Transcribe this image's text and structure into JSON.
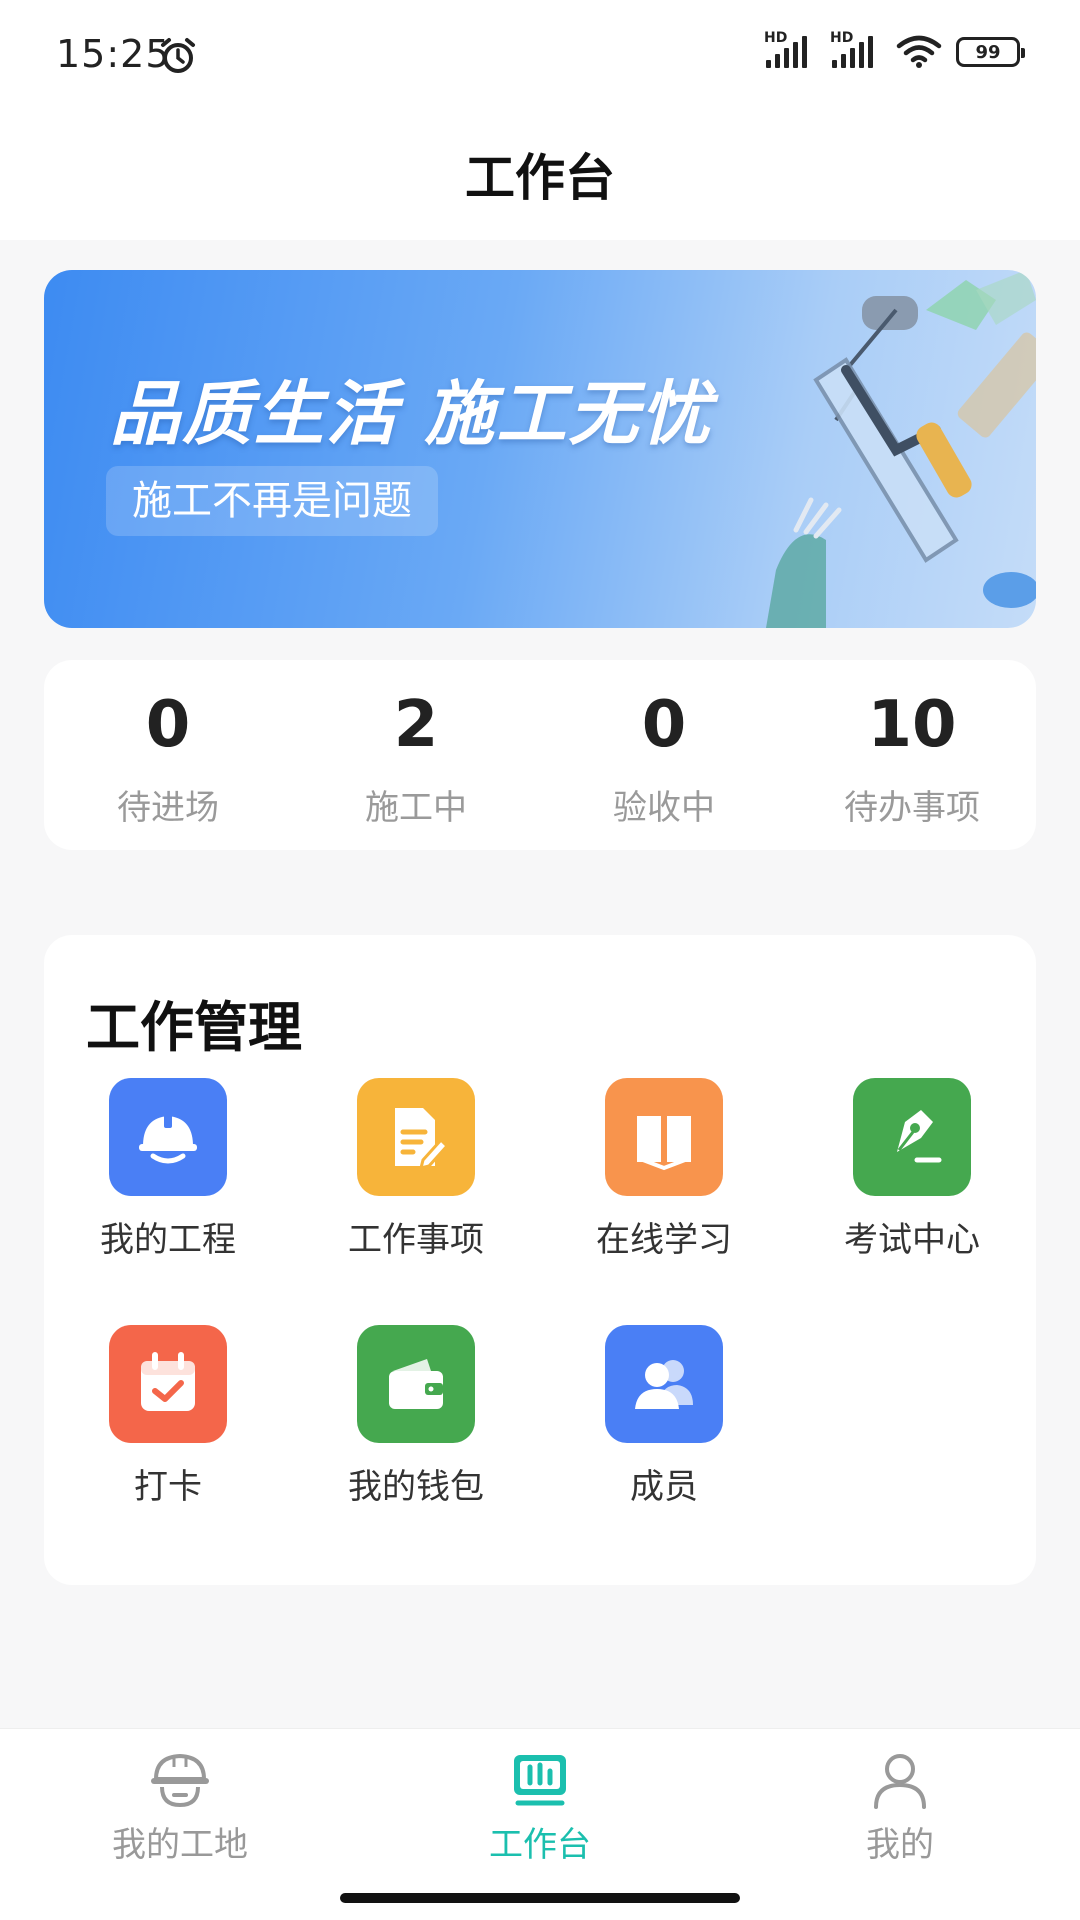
{
  "status_bar": {
    "time": "15:25",
    "signal1_label": "HD",
    "signal2_label": "HD",
    "battery": "99"
  },
  "header": {
    "title": "工作台"
  },
  "banner": {
    "title": "品质生活 施工无忧",
    "subtitle": "施工不再是问题"
  },
  "stats": [
    {
      "value": "0",
      "label": "待进场"
    },
    {
      "value": "2",
      "label": "施工中"
    },
    {
      "value": "0",
      "label": "验收中"
    },
    {
      "value": "10",
      "label": "待办事项"
    }
  ],
  "work_management": {
    "title": "工作管理",
    "items": [
      {
        "label": "我的工程",
        "icon": "helmet-icon",
        "color": "#4a7ff5"
      },
      {
        "label": "工作事项",
        "icon": "document-edit-icon",
        "color": "#f7b43a"
      },
      {
        "label": "在线学习",
        "icon": "book-icon",
        "color": "#f8944d"
      },
      {
        "label": "考试中心",
        "icon": "pen-icon",
        "color": "#45a84f"
      },
      {
        "label": "打卡",
        "icon": "calendar-check-icon",
        "color": "#f4664a"
      },
      {
        "label": "我的钱包",
        "icon": "wallet-icon",
        "color": "#45a84f"
      },
      {
        "label": "成员",
        "icon": "members-icon",
        "color": "#4a7ff5"
      }
    ]
  },
  "bottom_nav": {
    "items": [
      {
        "label": "我的工地",
        "icon": "helmet-face-icon",
        "active": false
      },
      {
        "label": "工作台",
        "icon": "dashboard-icon",
        "active": true
      },
      {
        "label": "我的",
        "icon": "user-icon",
        "active": false
      }
    ],
    "active_color": "#1bbfae"
  }
}
